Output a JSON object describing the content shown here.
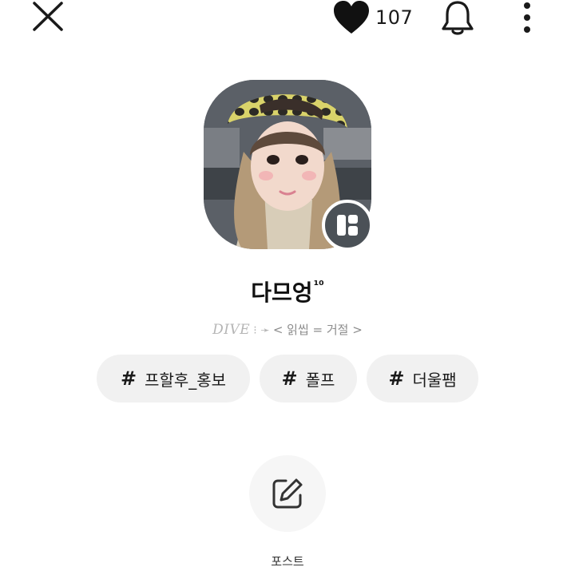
{
  "header": {
    "close_icon": "close-icon",
    "likes_icon": "heart-icon",
    "likes_count": "107",
    "bell_icon": "bell-icon",
    "more_icon": "more-vertical-icon"
  },
  "profile": {
    "nickname": "다므엉",
    "nickname_superscript": "¹⁰",
    "bio_dive": "DIVE",
    "bio_arrow": "⁝ ➛",
    "bio_text": "< 읽씹 = 거절 >",
    "badge_icon": "layout-icon"
  },
  "tags": [
    {
      "hash": "#",
      "label": "프할후_홍보"
    },
    {
      "hash": "#",
      "label": "폴프"
    },
    {
      "hash": "#",
      "label": "더울팸"
    }
  ],
  "actions": {
    "post_icon": "edit-icon",
    "post_label": "포스트"
  },
  "colors": {
    "tag_bg": "#f1f1f1",
    "badge_bg": "#4b5157",
    "text_primary": "#111111",
    "text_muted": "#8c8c8c"
  }
}
